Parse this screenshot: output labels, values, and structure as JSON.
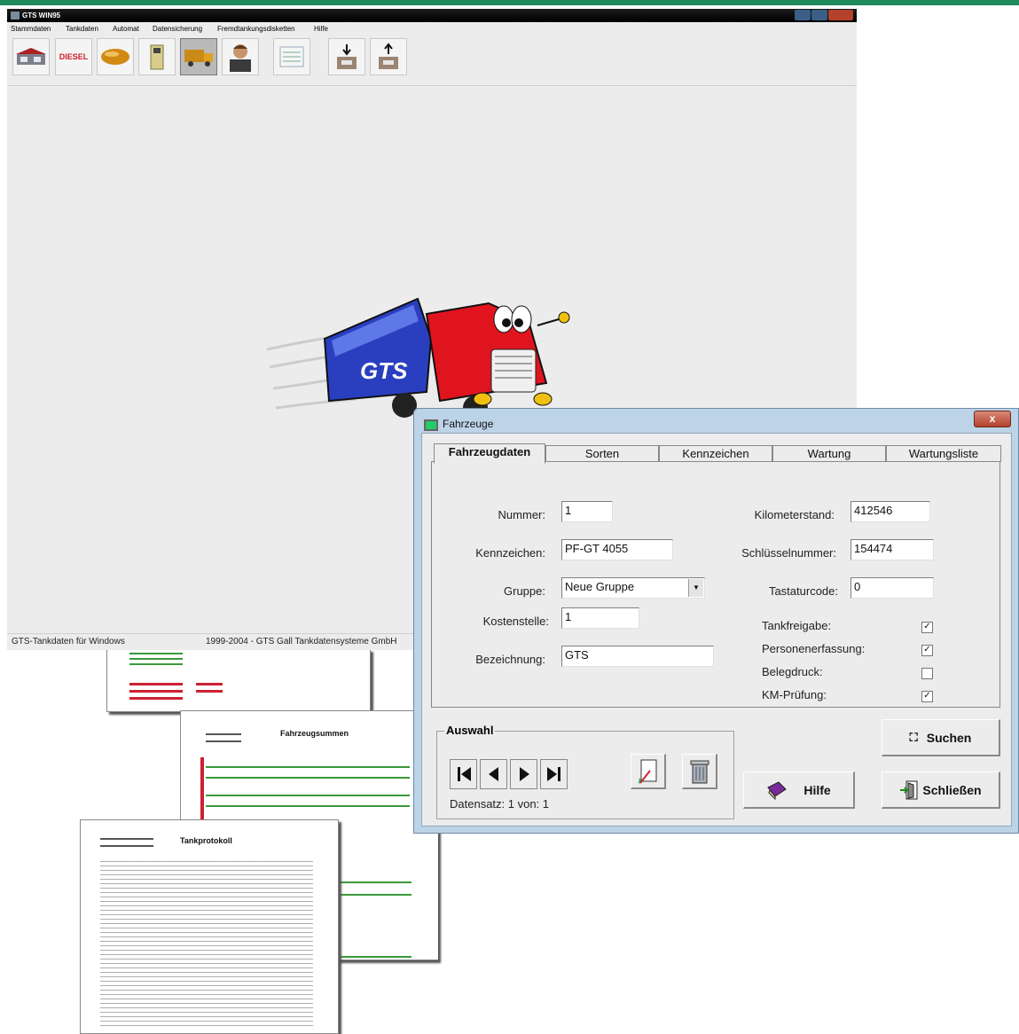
{
  "app": {
    "title": "GTS WIN95",
    "menu": [
      "Stammdaten",
      "Tankdaten",
      "Automat",
      "Datensicherung",
      "Fremdtankungsdisketten",
      "Hilfe"
    ],
    "toolbar_diesel_label": "DIESEL",
    "toolbar_icons": [
      "station-icon",
      "diesel-icon",
      "tank-icon",
      "fuel-pump-icon",
      "truck-icon",
      "person-icon",
      "list-icon",
      "download-icon",
      "upload-icon"
    ],
    "logo_text": "GTS",
    "status_left": "GTS-Tankdaten für Windows",
    "status_right": "1999-2004 - GTS Gall Tankdatensysteme GmbH"
  },
  "reports": {
    "page2_title": "Fahrzeugsummen",
    "page3_title": "Tankprotokoll"
  },
  "dialog": {
    "title": "Fahrzeuge",
    "close_label": "x",
    "tabs": [
      "Fahrzeugdaten",
      "Sorten",
      "Kennzeichen",
      "Wartung",
      "Wartungsliste"
    ],
    "active_tab": "Fahrzeugdaten",
    "fields": {
      "nummer_label": "Nummer:",
      "nummer_value": "1",
      "kennzeichen_label": "Kennzeichen:",
      "kennzeichen_value": "PF-GT 4055",
      "gruppe_label": "Gruppe:",
      "gruppe_value": "Neue Gruppe",
      "kostenstelle_label": "Kostenstelle:",
      "kostenstelle_value": "1",
      "bezeichnung_label": "Bezeichnung:",
      "bezeichnung_value": "GTS",
      "km_label": "Kilometerstand:",
      "km_value": "412546",
      "schluessel_label": "Schlüsselnummer:",
      "schluessel_value": "154474",
      "tastatur_label": "Tastaturcode:",
      "tastatur_value": "0"
    },
    "checks": [
      {
        "label": "Tankfreigabe:",
        "checked": true
      },
      {
        "label": "Personenerfassung:",
        "checked": true
      },
      {
        "label": "Belegdruck:",
        "checked": false
      },
      {
        "label": "KM-Prüfung:",
        "checked": true
      }
    ],
    "auswahl_label": "Auswahl",
    "datensatz_text": "Datensatz: 1 von: 1",
    "buttons": {
      "suchen": "Suchen",
      "hilfe": "Hilfe",
      "schliessen": "Schließen"
    },
    "colors": {
      "accent": "#1f8a5b",
      "dialog_frame": "#bcd3e8",
      "close": "#b3412c"
    }
  }
}
